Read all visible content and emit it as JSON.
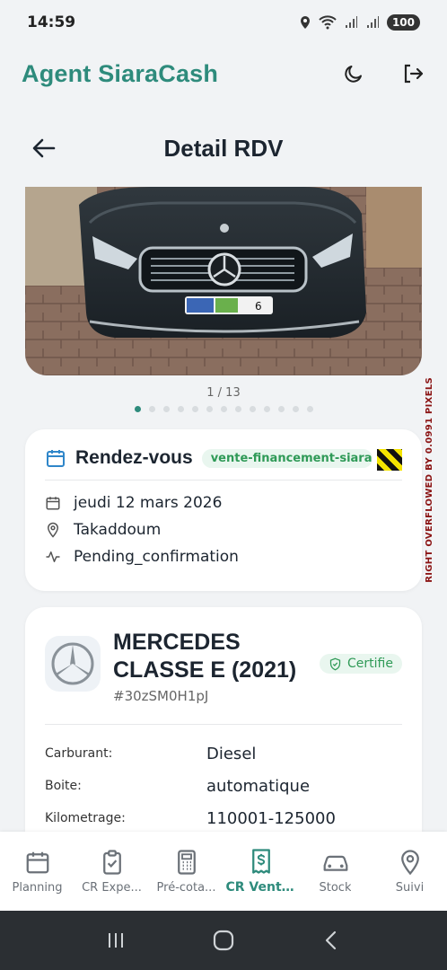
{
  "status": {
    "time": "14:59",
    "battery": "100"
  },
  "header": {
    "brand": "Agent SiaraCash"
  },
  "page": {
    "title": "Detail RDV"
  },
  "gallery": {
    "counter": "1 / 13",
    "total_dots": 13,
    "active_index": 0
  },
  "appointment": {
    "title": "Rendez-vous",
    "tag": "vente-financement-siara",
    "date": "jeudi 12 mars 2026",
    "location": "Takaddoum",
    "status": "Pending_confirmation"
  },
  "debug": {
    "overflow": "RIGHT OVERFLOWED BY 0.0991 PIXELS"
  },
  "car": {
    "name": "MERCEDES CLASSE E (2021)",
    "id": "#30zSM0H1pJ",
    "certified_label": "Certifie",
    "specs": [
      {
        "label": "Carburant:",
        "value": "Diesel"
      },
      {
        "label": "Boite:",
        "value": "automatique"
      },
      {
        "label": "Kilometrage:",
        "value": "110001-125000"
      }
    ]
  },
  "nav": {
    "items": [
      {
        "label": "Planning",
        "icon": "calendar-icon"
      },
      {
        "label": "CR Expe...",
        "icon": "clipboard-check-icon"
      },
      {
        "label": "Pré-cota...",
        "icon": "calculator-icon"
      },
      {
        "label": "CR Ventes",
        "icon": "receipt-dollar-icon"
      },
      {
        "label": "Stock",
        "icon": "car-icon"
      },
      {
        "label": "Suivi",
        "icon": "map-pin-icon"
      }
    ],
    "active": "CR Ventes"
  },
  "colors": {
    "accent": "#2e8b7c",
    "tag_bg": "#e9f6ef",
    "tag_fg": "#2f9a57",
    "background": "#f1f3f5"
  }
}
